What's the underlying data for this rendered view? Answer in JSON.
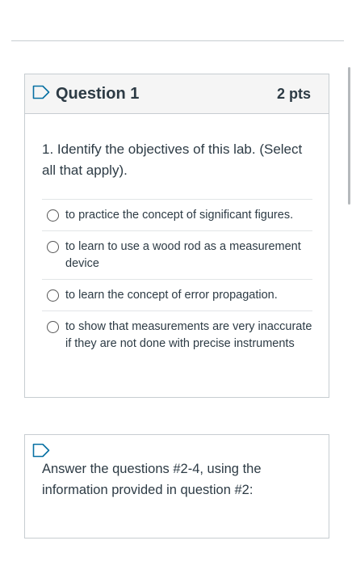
{
  "question1": {
    "title": "Question 1",
    "points": "2 pts",
    "text": "1. Identify the objectives of this lab. (Select all that apply).",
    "answers": [
      "to practice the concept of significant figures.",
      "to learn to use a wood rod as a measurement device",
      "to learn the concept of error propagation.",
      "to show that measurements are very inaccurate if they are not done with precise instruments"
    ]
  },
  "question2": {
    "text": "Answer the questions #2-4, using the information provided in question #2:"
  },
  "icons": {
    "flag": "flag-outline-icon",
    "radio": "radio-unchecked-icon"
  },
  "colors": {
    "flag_outline": "#0770a3",
    "text": "#2d3b45",
    "border": "#c7cdd1",
    "header_bg": "#f5f5f5"
  }
}
